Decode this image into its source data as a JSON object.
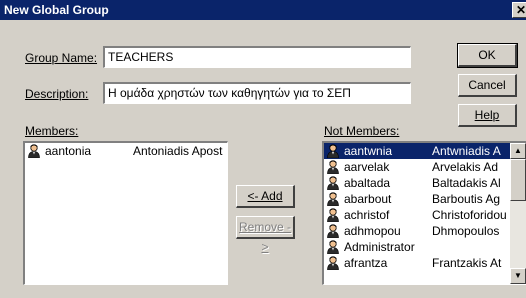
{
  "window": {
    "title": "New Global Group",
    "close_label": "✕"
  },
  "form": {
    "group_name_label": "Group Name:",
    "group_name_value": "TEACHERS",
    "description_label": "Description:",
    "description_value": "Η ομάδα χρηστών των καθηγητών για το ΣΕΠ"
  },
  "buttons": {
    "ok": "OK",
    "cancel": "Cancel",
    "help": "Help",
    "add": "<- Add",
    "remove": "Remove ->"
  },
  "members": {
    "label": "Members:",
    "items": [
      {
        "account": "aantonia",
        "full_name": "Antoniadis Apost"
      }
    ]
  },
  "not_members": {
    "label": "Not Members:",
    "selected_index": 0,
    "items": [
      {
        "account": "aantwnia",
        "full_name": "Antwniadis A"
      },
      {
        "account": "aarvelak",
        "full_name": "Arvelakis Ad"
      },
      {
        "account": "abaltada",
        "full_name": "Baltadakis Al"
      },
      {
        "account": "abarbout",
        "full_name": "Barboutis Ag"
      },
      {
        "account": "achristof",
        "full_name": "Christoforidou"
      },
      {
        "account": "adhmopou",
        "full_name": "Dhmopoulos"
      },
      {
        "account": "Administrator",
        "full_name": ""
      },
      {
        "account": "afrantza",
        "full_name": "Frantzakis At"
      }
    ]
  },
  "icons": {
    "user": "user-icon",
    "scroll_up": "scroll-up-icon",
    "scroll_down": "scroll-down-icon"
  },
  "colors": {
    "title_bar": "#0a246a",
    "selection": "#0a246a",
    "face": "#d4d0c8"
  }
}
